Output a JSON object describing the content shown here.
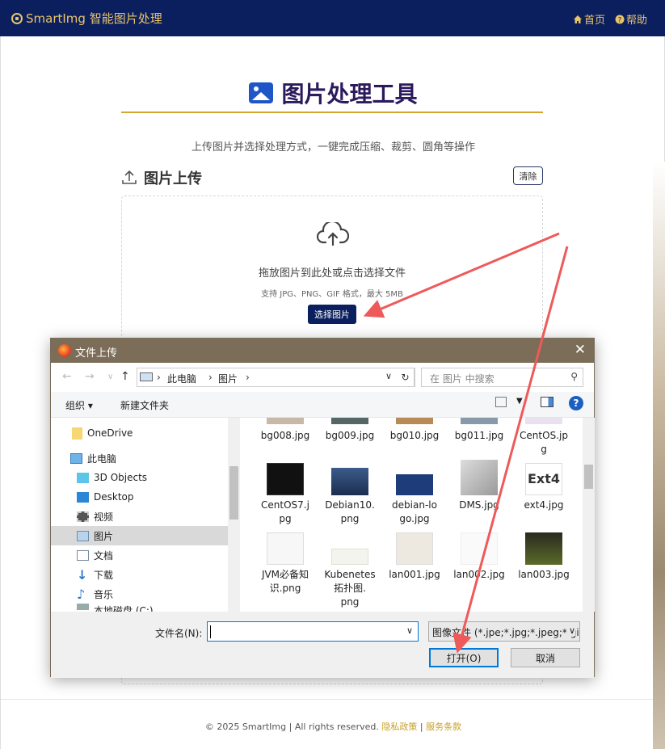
{
  "header": {
    "brand": "SmartImg 智能图片处理",
    "nav": [
      "首页",
      "帮助"
    ]
  },
  "main": {
    "title": "图片处理工具",
    "subtitle": "上传图片并选择处理方式，一键完成压缩、裁剪、圆角等操作",
    "upload_heading": "图片上传",
    "clear_label": "清除",
    "drop_text": "拖放图片到此处或点击选择文件",
    "drop_hint": "支持 JPG、PNG、GIF 格式，最大 5MB",
    "choose_label": "选择图片"
  },
  "footer": {
    "copyright": "© 2025 SmartImg | All rights reserved.",
    "privacy": "隐私政策",
    "sep": "|",
    "terms": "服务条款"
  },
  "dialog": {
    "title": "文件上传",
    "breadcrumb": [
      "此电脑",
      "图片"
    ],
    "search_placeholder": "在 图片 中搜索",
    "organize": "组织 ▾",
    "new_folder": "新建文件夹",
    "sidebar": [
      {
        "label": "OneDrive",
        "icon": "folder-icon"
      },
      {
        "label": "此电脑",
        "icon": "computer-icon"
      },
      {
        "label": "3D Objects",
        "icon": "cube-icon"
      },
      {
        "label": "Desktop",
        "icon": "desktop-icon"
      },
      {
        "label": "视频",
        "icon": "video-icon"
      },
      {
        "label": "图片",
        "icon": "pictures-icon",
        "selected": true
      },
      {
        "label": "文档",
        "icon": "document-icon"
      },
      {
        "label": "下载",
        "icon": "download-icon"
      },
      {
        "label": "音乐",
        "icon": "music-icon"
      },
      {
        "label": "本地磁盘 (C:)",
        "icon": "drive-icon"
      }
    ],
    "files": [
      [
        "bg008.jpg"
      ],
      [
        "bg009.jpg"
      ],
      [
        "bg010.jpg"
      ],
      [
        "bg011.jpg"
      ],
      [
        "CentOS.jp",
        "g"
      ],
      [
        "CentOS7.j",
        "pg"
      ],
      [
        "Debian10.",
        "png"
      ],
      [
        "debian-lo",
        "go.jpg"
      ],
      [
        "DMS.jpg"
      ],
      [
        "ext4.jpg"
      ],
      [
        "JVM必备知",
        "识.png"
      ],
      [
        "Kubenetes",
        "拓扑图.",
        "png"
      ],
      [
        "lan001.jpg"
      ],
      [
        "lan002.jpg"
      ],
      [
        "lan003.jpg"
      ]
    ],
    "filename_label": "文件名(N):",
    "filename_value": "",
    "filetype": "图像文件 (*.jpe;*.jpg;*.jpeg;*.gif;*.png)",
    "open_label": "打开(O)",
    "cancel_label": "取消"
  },
  "colors": {
    "header_bg": "#0b1f5e",
    "accent_gold": "#e9c46a",
    "annotation_red": "#ee5a5a",
    "dialog_title_bg": "#7b6d57"
  }
}
